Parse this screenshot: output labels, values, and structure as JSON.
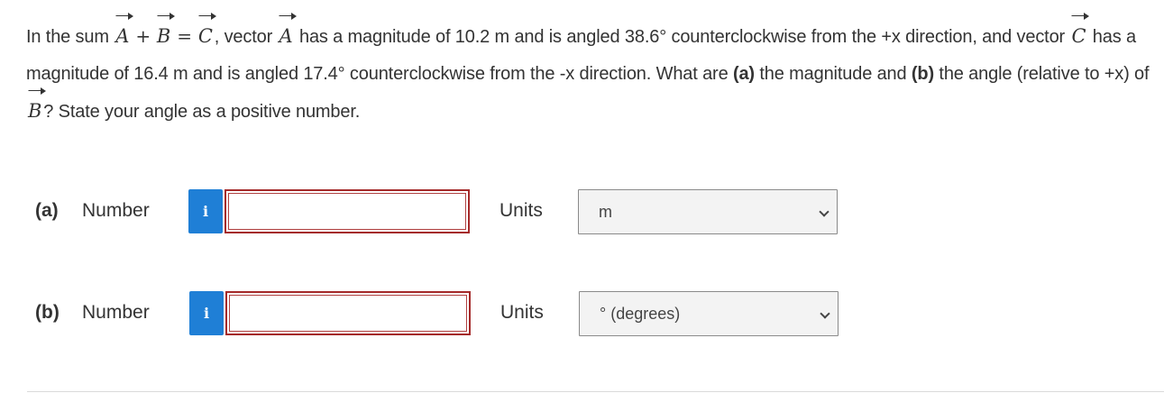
{
  "question": {
    "p1": "In the sum ",
    "vecA": "A",
    "plus": "+",
    "vecB": "B",
    "equals": "=",
    "vecC": "C",
    "p2": ", vector ",
    "vecA2": "A",
    "p3": " has a magnitude of 10.2 m and is angled 38.6° counterclockwise from the +x direction, and vector ",
    "vecC2": "C",
    "p4": " has a magnitude of 16.4 m and is angled 17.4° counterclockwise from the -x direction. What are ",
    "part_a": "(a)",
    "p5": " the magnitude and ",
    "part_b": "(b)",
    "p6": " the angle (relative to +x) of ",
    "vecB2": "B",
    "p7": "? State your angle as a positive number."
  },
  "rows": [
    {
      "part": "(a)",
      "label": "Number",
      "info": "i",
      "value": "",
      "units_label": "Units",
      "units_value": "m"
    },
    {
      "part": "(b)",
      "label": "Number",
      "info": "i",
      "value": "",
      "units_label": "Units",
      "units_value": "° (degrees)"
    }
  ],
  "colors": {
    "info_button": "#1f7fd6",
    "answer_border": "#a52a2a",
    "select_bg": "#f3f3f3"
  }
}
